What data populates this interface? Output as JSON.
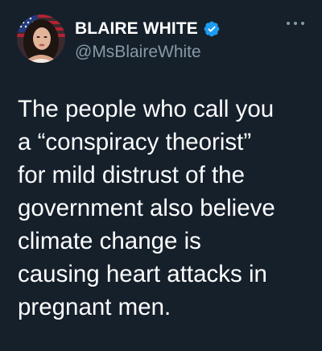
{
  "author": {
    "display_name": "BLAIRE WHITE",
    "handle": "@MsBlaireWhite",
    "verified": true,
    "avatar_icon": "profile-photo-avatar"
  },
  "menu": {
    "more_icon": "more-horizontal-icon"
  },
  "tweet": {
    "lines": [
      "The people who call you",
      "a “conspiracy theorist”",
      "for mild distrust of the",
      "government also believe",
      "climate change is",
      "causing heart attacks in",
      "pregnant men."
    ]
  },
  "colors": {
    "background": "#15202b",
    "text": "#ffffff",
    "secondary_text": "#8899a6",
    "verified_badge": "#1d9bf0"
  }
}
